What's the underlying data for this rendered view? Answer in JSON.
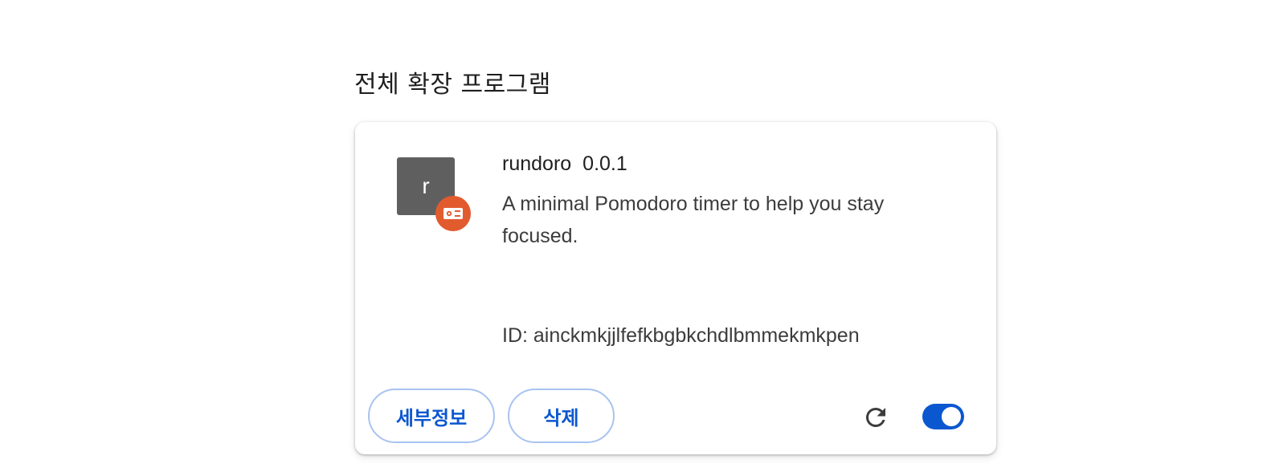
{
  "section": {
    "title": "전체 확장 프로그램"
  },
  "extension": {
    "icon_letter": "r",
    "icon_color": "#5f5f5f",
    "badge_color": "#e25b2f",
    "badge_icon": "unpacked-extension-icon",
    "name": "rundoro",
    "version": "0.0.1",
    "description": "A minimal Pomodoro timer to help you stay focused.",
    "id_text": "ID: ainckmkjjlfefkbgbkchdlbmmekmkpen",
    "enabled": true
  },
  "actions": {
    "details_label": "세부정보",
    "remove_label": "삭제",
    "reload_icon": "reload-icon",
    "accent_color": "#0b57d0"
  }
}
